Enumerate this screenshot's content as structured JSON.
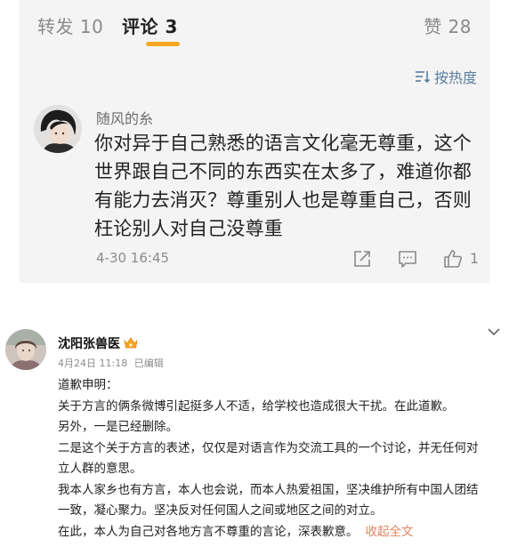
{
  "tabs": {
    "repost": "转发 10",
    "comment": "评论 3",
    "like": "赞 28"
  },
  "sort": {
    "label": "按热度",
    "icon": "sort-icon"
  },
  "comment": {
    "username": "随风的糸",
    "lines": [
      "你对异于自己熟悉的语言文化毫无尊重，这个",
      "世界跟自己不同的东西实在太多了，难道你都",
      "有能力去消灭？尊重别人也是尊重自己，否则",
      "枉论别人对自己没尊重"
    ],
    "time": "4-30 16:45",
    "like_count": "1"
  },
  "post": {
    "username": "沈阳张兽医",
    "date": "4月24日 11:18",
    "edited": "已编辑",
    "lines": [
      "道歉申明：",
      "关于方言的俩条微博引起挺多人不适，给学校也造成很大干扰。在此道歉。",
      "另外，一是已经删除。",
      "二是这个关于方言的表述，仅仅是对语言作为交流工具的一个讨论，并无任何对",
      "立人群的意思。",
      "我本人家乡也有方言，本人也会说，而本人热爱祖国，坚决维护所有中国人团结",
      "一致，凝心聚力。坚决反对任何国人之间或地区之间的对立。"
    ],
    "last_line": "在此，本人为自己对各地方言不尊重的言论，深表歉意。",
    "collapse_label": "收起全文"
  },
  "colors": {
    "card_bg": "#f4f4f4",
    "tab_accent": "#f5a623",
    "sort_blue": "#5b7ea0",
    "link_orange": "#e2845f"
  }
}
